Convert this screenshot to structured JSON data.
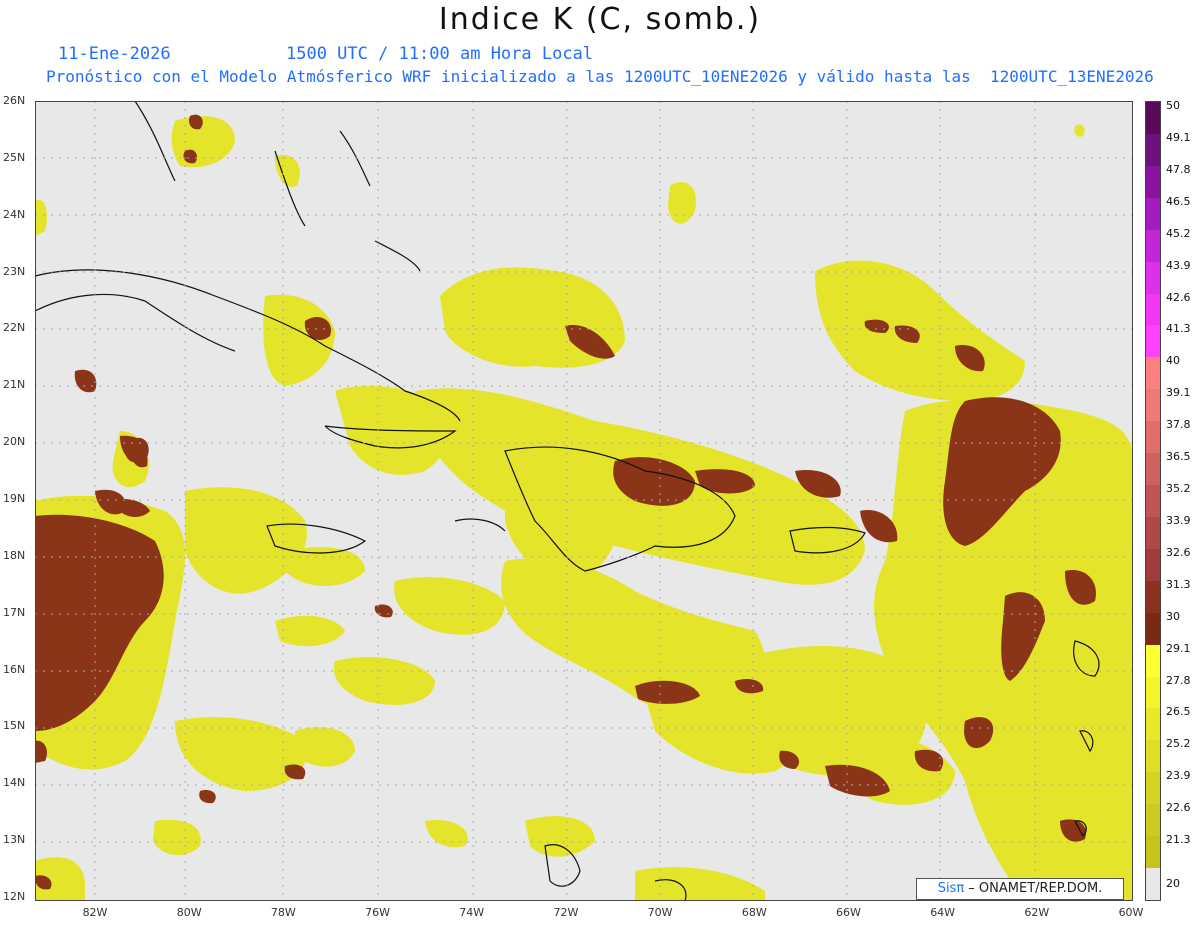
{
  "title": "Indice K (C, somb.)",
  "date_label": "11-Ene-2026",
  "time_label": "1500 UTC / 11:00 am Hora Local",
  "forecast_line": "Pronóstico con el Modelo Atmósferico WRF inicializado a las 1200UTC_10ENE2026 y válido hasta las  1200UTC_13ENE2026",
  "credit": {
    "brand": "Sisπ",
    "org": " – ONAMET/REP.DOM."
  },
  "axes": {
    "lat_labels": [
      "26N",
      "25N",
      "24N",
      "23N",
      "22N",
      "21N",
      "20N",
      "19N",
      "18N",
      "17N",
      "16N",
      "15N",
      "14N",
      "13N",
      "12N"
    ],
    "lon_labels": [
      "82W",
      "80W",
      "78W",
      "76W",
      "74W",
      "72W",
      "70W",
      "68W",
      "66W",
      "64W",
      "62W",
      "60W"
    ]
  },
  "colorbar": {
    "levels": [
      "50",
      "49.1",
      "47.8",
      "46.5",
      "45.2",
      "43.9",
      "42.6",
      "41.3",
      "40",
      "39.1",
      "37.8",
      "36.5",
      "35.2",
      "33.9",
      "32.6",
      "31.3",
      "30",
      "29.1",
      "27.8",
      "26.5",
      "25.2",
      "23.9",
      "22.6",
      "21.3",
      "20"
    ],
    "colors": [
      "#5a0a5a",
      "#6e1080",
      "#8a14a0",
      "#a41cc0",
      "#c226d8",
      "#dc30ea",
      "#f236f6",
      "#ff40ff",
      "#ff8080",
      "#f07878",
      "#e06c6c",
      "#d06060",
      "#c05454",
      "#b04848",
      "#a03c3c",
      "#8c3020",
      "#7a2a12",
      "#ffff33",
      "#f4f42a",
      "#e8e828",
      "#dede26",
      "#d4d424",
      "#cccc20",
      "#c4c41c",
      "#e8e8e8"
    ]
  },
  "map": {
    "background": "#e8e8e8",
    "yellow_fill": "#e6e62c",
    "brown_fill": "#8a3418",
    "coast_color": "#111111"
  }
}
